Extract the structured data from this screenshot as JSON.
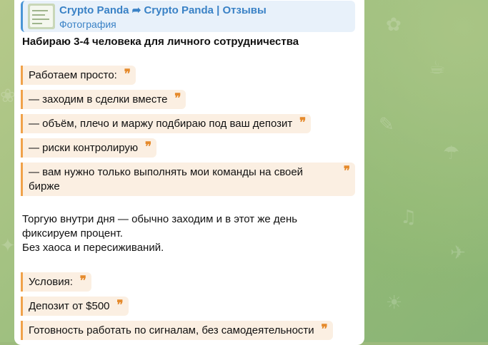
{
  "reply": {
    "title_from": "Crypto Panda",
    "title_to": "Crypto Panda | Отзывы",
    "subtitle": "Фотография"
  },
  "message": {
    "heading": "Набираю 3-4 человека для личного сотрудничества",
    "quotes_1": [
      "Работаем просто:",
      "— заходим в сделки вместе",
      "— объём, плечо и маржу подбираю под ваш депозит",
      "— риски контролирую",
      "— вам нужно только выполнять мои команды на своей бирже"
    ],
    "paragraph": [
      "Торгую внутри дня — обычно заходим и в этот же день",
      "фиксируем процент.",
      "Без хаоса и пересиживаний."
    ],
    "quotes_2": [
      "Условия:",
      "Депозит от $500",
      "Готовность работать по сигналам, без самодеятельности"
    ]
  },
  "icons": {
    "forward": "forward-arrow-icon",
    "quote": "quote-mark-icon"
  },
  "colors": {
    "accent_blue": "#3a82c6",
    "quote_orange": "#e58a2c",
    "quote_bg": "#fbefe2",
    "chat_bg": "#9cba7c"
  }
}
